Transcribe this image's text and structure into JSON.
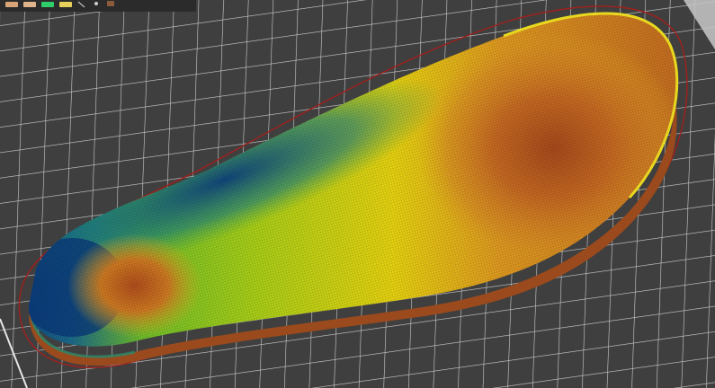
{
  "window": {
    "title": ""
  },
  "toolbar": {
    "swatches": [
      {
        "name": "filament-swatch-1",
        "color": "#d9a478"
      },
      {
        "name": "filament-swatch-2",
        "color": "#e0b48a"
      },
      {
        "name": "filament-swatch-3",
        "color": "#2ecf6a"
      },
      {
        "name": "filament-swatch-4",
        "color": "#e8d05a"
      }
    ],
    "icons": [
      "arrow-icon",
      "dot-icon",
      "object-icon"
    ]
  },
  "viewport": {
    "background": "#3f3f3f",
    "grid_color": "#d8d8d8",
    "skirt_color": "#a0201c",
    "heatmap_colors": [
      "#0a3a7a",
      "#14a08a",
      "#9fd020",
      "#f0e010",
      "#e09a20",
      "#b8561e"
    ]
  }
}
